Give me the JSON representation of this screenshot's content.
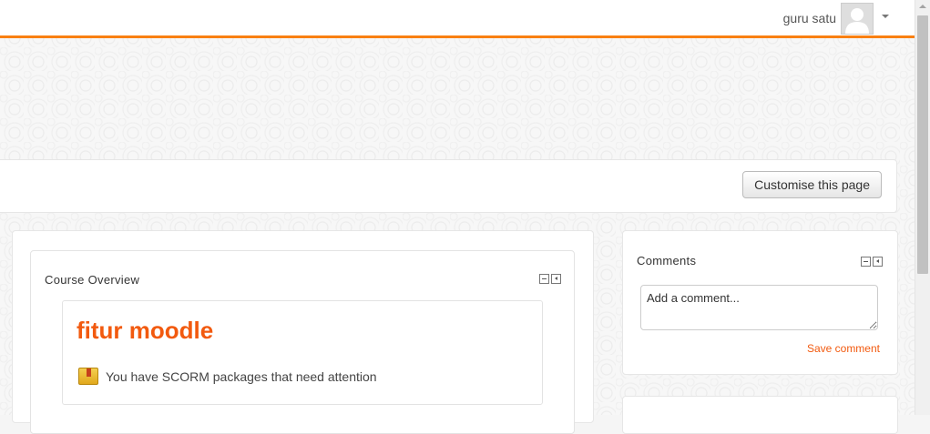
{
  "header": {
    "user_name": "guru satu",
    "avatar_icon": "user-silhouette-icon",
    "accent_color": "#f98012"
  },
  "page_header": {
    "customise_button": "Customise this page"
  },
  "course_overview": {
    "title": "Course Overview",
    "course": {
      "name": "fitur moodle",
      "notice_icon": "scorm-package-icon",
      "notice": "You have SCORM packages that need attention"
    }
  },
  "comments": {
    "title": "Comments",
    "placeholder": "Add a comment...",
    "save_label": "Save comment"
  },
  "colors": {
    "link": "#f25a0f"
  }
}
